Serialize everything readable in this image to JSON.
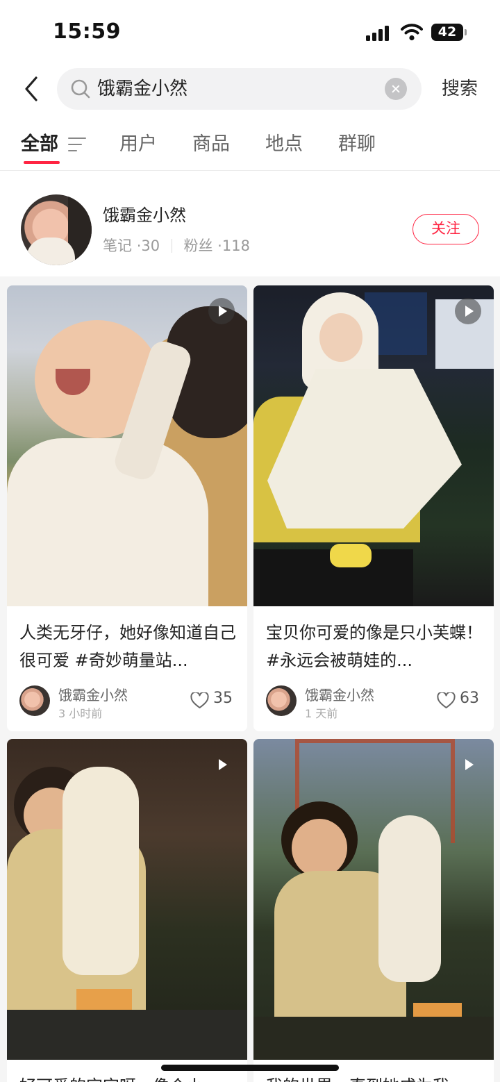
{
  "status_bar": {
    "time": "15:59",
    "battery": "42"
  },
  "search": {
    "query": "饿霸金小然",
    "submit_label": "搜索"
  },
  "tabs": [
    {
      "label": "全部",
      "active": true
    },
    {
      "label": "用户",
      "active": false
    },
    {
      "label": "商品",
      "active": false
    },
    {
      "label": "地点",
      "active": false
    },
    {
      "label": "群聊",
      "active": false
    }
  ],
  "user_card": {
    "name": "饿霸金小然",
    "notes_label": "笔记",
    "notes_count": "30",
    "fans_label": "粉丝",
    "fans_count": "118",
    "follow_label": "关注"
  },
  "notes": [
    {
      "title": "人类无牙仔，她好像知道自己很可爱 #奇妙萌量站...",
      "author": "饿霸金小然",
      "time": "3 小时前",
      "likes": "35",
      "is_video": true
    },
    {
      "title": "宝贝你可爱的像是只小芙蝶！ #永远会被萌娃的...",
      "author": "饿霸金小然",
      "time": "1 天前",
      "likes": "63",
      "is_video": true
    },
    {
      "title": "好可爱的宝宝呀，像个小...",
      "author": "",
      "time": "",
      "likes": "",
      "is_video": true
    },
    {
      "title": "我的世界，直到她成为我...",
      "author": "",
      "time": "",
      "likes": "",
      "is_video": true
    }
  ],
  "colors": {
    "accent": "#ff2442",
    "feed_bg": "#f5f5f5",
    "search_bg": "#f2f2f3"
  },
  "icons": [
    "back-arrow-icon",
    "search-icon",
    "clear-icon",
    "filter-icon",
    "play-icon",
    "heart-icon",
    "signal-icon",
    "wifi-icon",
    "battery-icon"
  ]
}
